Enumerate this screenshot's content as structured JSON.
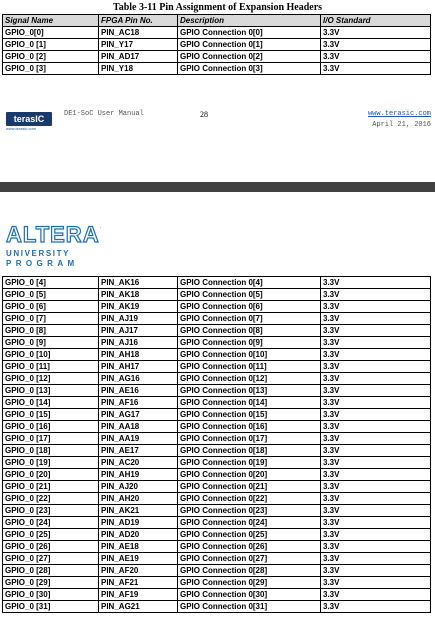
{
  "page1": {
    "caption": "Table 3-11 Pin Assignment of Expansion Headers",
    "headers": [
      "Signal Name",
      "FPGA Pin No.",
      "Description",
      "I/O Standard"
    ],
    "rows": [
      [
        "GPIO_0[0]",
        "PIN_AC18",
        "GPIO Connection 0[0]",
        "3.3V"
      ],
      [
        "GPIO_0 [1]",
        "PIN_Y17",
        "GPIO Connection 0[1]",
        "3.3V"
      ],
      [
        "GPIO_0 [2]",
        "PIN_AD17",
        "GPIO Connection 0[2]",
        "3.3V"
      ],
      [
        "GPIO_0 [3]",
        "PIN_Y18",
        "GPIO Connection 0[3]",
        "3.3V"
      ]
    ],
    "footer": {
      "logo": "terasIC",
      "logo_sub": "www.terasic.com",
      "manual": "DE1-SoC User Manual",
      "page_number": "28",
      "url": "www.terasic.com",
      "date": "April 21, 2016"
    }
  },
  "page2": {
    "logo_word": "ALTERA",
    "logo_reg": ".",
    "program_line1": "UNIVERSITY",
    "program_line2": "PROGRAM",
    "rows": [
      [
        "GPIO_0 [4]",
        "PIN_AK16",
        "GPIO Connection 0[4]",
        "3.3V"
      ],
      [
        "GPIO_0 [5]",
        "PIN_AK18",
        "GPIO Connection 0[5]",
        "3.3V"
      ],
      [
        "GPIO_0 [6]",
        "PIN_AK19",
        "GPIO Connection 0[6]",
        "3.3V"
      ],
      [
        "GPIO_0 [7]",
        "PIN_AJ19",
        "GPIO Connection 0[7]",
        "3.3V"
      ],
      [
        "GPIO_0 [8]",
        "PIN_AJ17",
        "GPIO Connection 0[8]",
        "3.3V"
      ],
      [
        "GPIO_0 [9]",
        "PIN_AJ16",
        "GPIO Connection 0[9]",
        "3.3V"
      ],
      [
        "GPIO_0 [10]",
        "PIN_AH18",
        "GPIO Connection 0[10]",
        "3.3V"
      ],
      [
        "GPIO_0 [11]",
        "PIN_AH17",
        "GPIO Connection 0[11]",
        "3.3V"
      ],
      [
        "GPIO_0 [12]",
        "PIN_AG16",
        "GPIO Connection 0[12]",
        "3.3V"
      ],
      [
        "GPIO_0 [13]",
        "PIN_AE16",
        "GPIO Connection 0[13]",
        "3.3V"
      ],
      [
        "GPIO_0 [14]",
        "PIN_AF16",
        "GPIO Connection 0[14]",
        "3.3V"
      ],
      [
        "GPIO_0 [15]",
        "PIN_AG17",
        "GPIO Connection 0[15]",
        "3.3V"
      ],
      [
        "GPIO_0 [16]",
        "PIN_AA18",
        "GPIO Connection 0[16]",
        "3.3V"
      ],
      [
        "GPIO_0 [17]",
        "PIN_AA19",
        "GPIO Connection 0[17]",
        "3.3V"
      ],
      [
        "GPIO_0 [18]",
        "PIN_AE17",
        "GPIO Connection 0[18]",
        "3.3V"
      ],
      [
        "GPIO_0 [19]",
        "PIN_AC20",
        "GPIO Connection 0[19]",
        "3.3V"
      ],
      [
        "GPIO_0 [20]",
        "PIN_AH19",
        "GPIO Connection 0[20]",
        "3.3V"
      ],
      [
        "GPIO_0 [21]",
        "PIN_AJ20",
        "GPIO Connection 0[21]",
        "3.3V"
      ],
      [
        "GPIO_0 [22]",
        "PIN_AH20",
        "GPIO Connection 0[22]",
        "3.3V"
      ],
      [
        "GPIO_0 [23]",
        "PIN_AK21",
        "GPIO Connection 0[23]",
        "3.3V"
      ],
      [
        "GPIO_0 [24]",
        "PIN_AD19",
        "GPIO Connection 0[24]",
        "3.3V"
      ],
      [
        "GPIO_0 [25]",
        "PIN_AD20",
        "GPIO Connection 0[25]",
        "3.3V"
      ],
      [
        "GPIO_0 [26]",
        "PIN_AE18",
        "GPIO Connection 0[26]",
        "3.3V"
      ],
      [
        "GPIO_0 [27]",
        "PIN_AE19",
        "GPIO Connection 0[27]",
        "3.3V"
      ],
      [
        "GPIO_0 [28]",
        "PIN_AF20",
        "GPIO Connection 0[28]",
        "3.3V"
      ],
      [
        "GPIO_0 [29]",
        "PIN_AF21",
        "GPIO Connection 0[29]",
        "3.3V"
      ],
      [
        "GPIO_0 [30]",
        "PIN_AF19",
        "GPIO Connection 0[30]",
        "3.3V"
      ],
      [
        "GPIO_0 [31]",
        "PIN_AG21",
        "GPIO Connection 0[31]",
        "3.3V"
      ]
    ]
  },
  "colors": {
    "header_fill": "#d9d9d9",
    "viewer_gap": "#414141",
    "altera_blue": "#1d6fb8",
    "terasic_navy": "#1b3a6b",
    "link_blue": "#2256c0"
  }
}
